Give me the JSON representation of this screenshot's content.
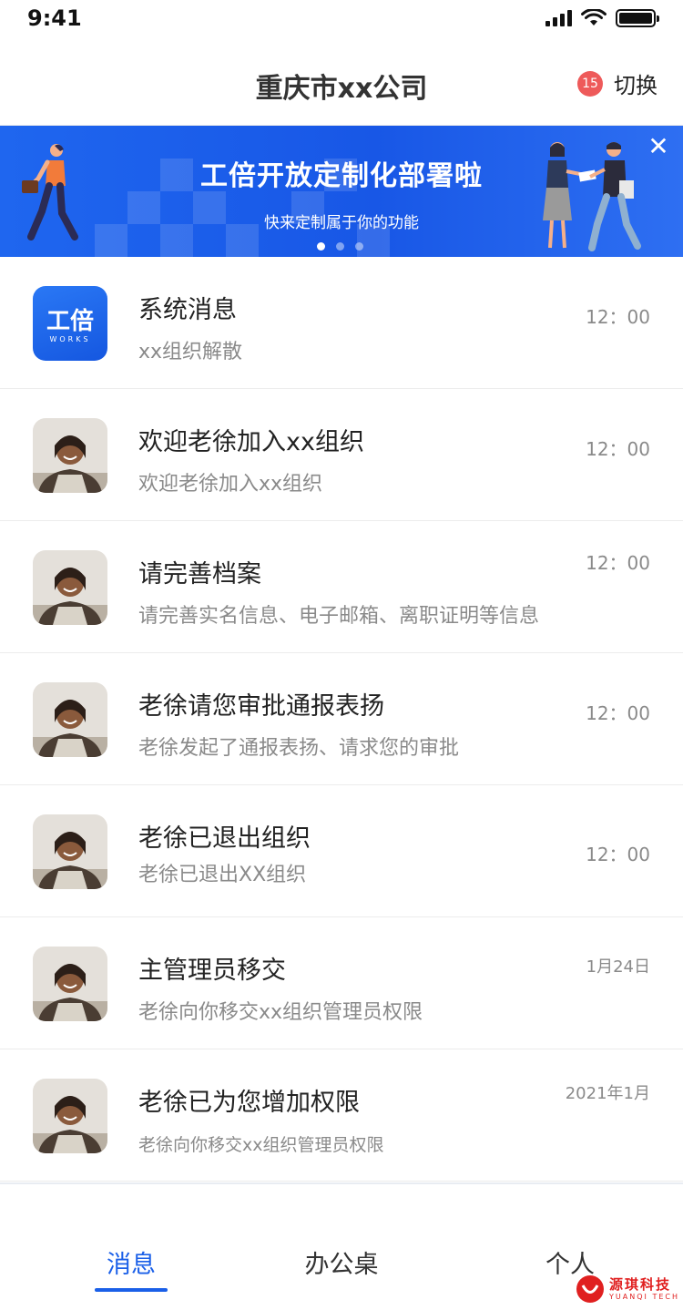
{
  "status_bar": {
    "time": "9:41"
  },
  "header": {
    "title": "重庆市xx公司",
    "badge_count": "15",
    "switch_label": "切换"
  },
  "banner": {
    "title": "工倍开放定制化部署啦",
    "subtitle": "快来定制属于你的功能",
    "close_icon": "close-icon",
    "page_count": 3,
    "active_page": 1
  },
  "system_logo": {
    "name": "工倍",
    "sub": "WORKS"
  },
  "messages": [
    {
      "title": "系统消息",
      "subtitle": "xx组织解散",
      "time": "12：00",
      "avatar": "system-logo"
    },
    {
      "title": "欢迎老徐加入xx组织",
      "subtitle": "欢迎老徐加入xx组织",
      "time": "12：00",
      "avatar": "user-photo"
    },
    {
      "title": "请完善档案",
      "subtitle": "请完善实名信息、电子邮箱、离职证明等信息",
      "time": "12：00",
      "avatar": "user-photo"
    },
    {
      "title": "老徐请您审批通报表扬",
      "subtitle": "老徐发起了通报表扬、请求您的审批",
      "time": "12：00",
      "avatar": "user-photo"
    },
    {
      "title": "老徐已退出组织",
      "subtitle": "老徐已退出XX组织",
      "time": "12：00",
      "avatar": "user-photo"
    },
    {
      "title": "主管理员移交",
      "subtitle": "老徐向你移交xx组织管理员权限",
      "time": "1月24日",
      "avatar": "user-photo"
    },
    {
      "title": "老徐已为您增加权限",
      "subtitle": "老徐向你移交xx组织管理员权限",
      "time": "2021年1月",
      "avatar": "user-photo"
    }
  ],
  "tabbar": {
    "tabs": [
      {
        "label": "消息",
        "active": true
      },
      {
        "label": "办公桌",
        "active": false
      },
      {
        "label": "个人",
        "active": false
      }
    ]
  },
  "watermark": {
    "cn": "源琪科技",
    "en": "YUANQI TECH"
  },
  "colors": {
    "accent": "#1a5fe8",
    "badge": "#ee5a5a",
    "banner": "#1857e6"
  }
}
